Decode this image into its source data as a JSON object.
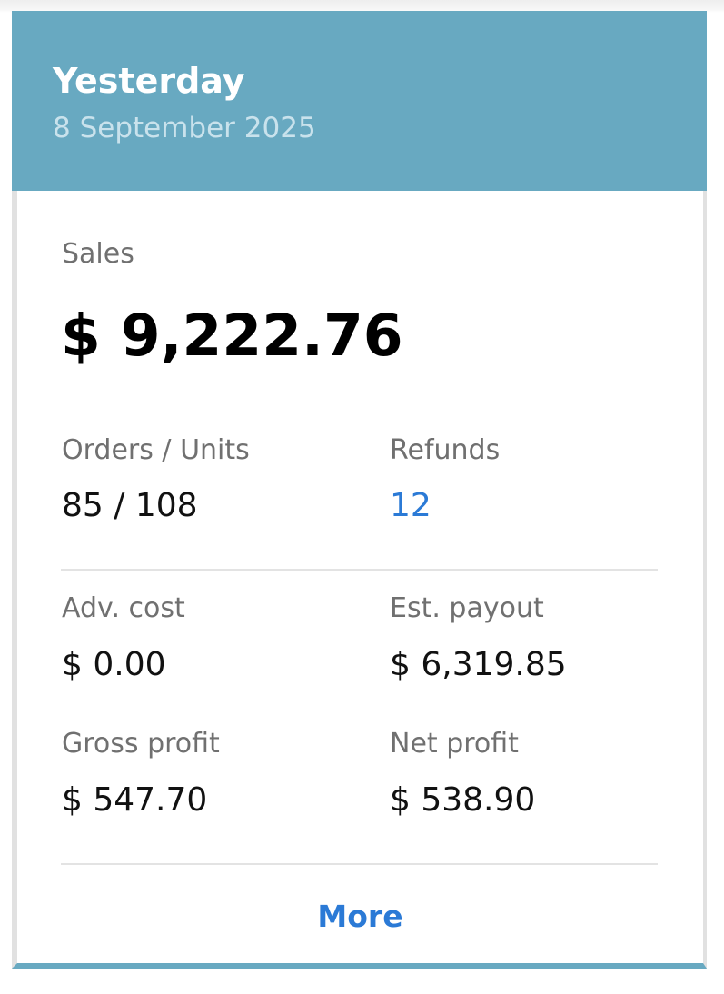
{
  "header": {
    "title": "Yesterday",
    "date": "8 September 2025",
    "background_color": "#68a9c1"
  },
  "sales": {
    "label": "Sales",
    "value": "$ 9,222.76"
  },
  "metrics": {
    "orders_units": {
      "label": "Orders / Units",
      "value": "85 / 108"
    },
    "refunds": {
      "label": "Refunds",
      "value": "12"
    },
    "adv_cost": {
      "label": "Adv. cost",
      "value": "$ 0.00"
    },
    "est_payout": {
      "label": "Est. payout",
      "value": "$ 6,319.85"
    },
    "gross_profit": {
      "label": "Gross profit",
      "value": "$ 547.70"
    },
    "net_profit": {
      "label": "Net profit",
      "value": "$ 538.90"
    }
  },
  "more_label": "More",
  "colors": {
    "accent_link": "#2b7ad6",
    "label_text": "#707070",
    "divider": "#e3e3e3"
  }
}
